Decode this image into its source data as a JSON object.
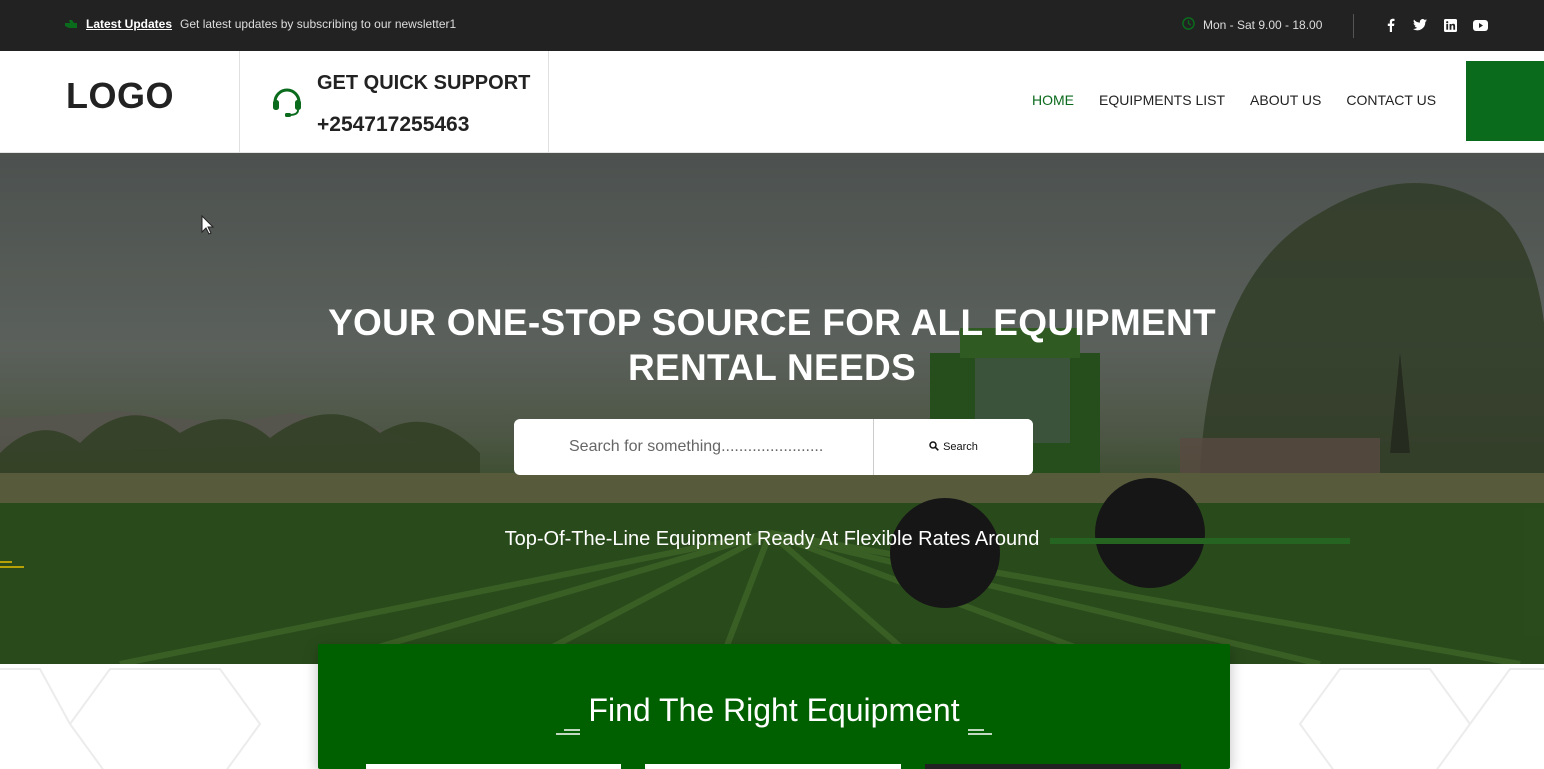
{
  "topbar": {
    "updates_label": "Latest Updates",
    "updates_text": "Get latest updates by subscribing to our newsletter1",
    "hours": "Mon - Sat 9.00 - 18.00",
    "socials": [
      "facebook-icon",
      "twitter-icon",
      "linkedin-icon",
      "youtube-icon"
    ]
  },
  "header": {
    "logo": "LOGO",
    "support_title": "GET QUICK SUPPORT",
    "support_phone": "+254717255463",
    "nav": [
      {
        "label": "HOME",
        "active": true
      },
      {
        "label": "EQUIPMENTS LIST",
        "active": false
      },
      {
        "label": "ABOUT US",
        "active": false
      },
      {
        "label": "CONTACT US",
        "active": false
      }
    ]
  },
  "hero": {
    "title_line1": "YOUR ONE-STOP SOURCE FOR ALL EQUIPMENT",
    "title_line2": "RENTAL NEEDS",
    "search_placeholder": "Search for something.......................",
    "search_button": "Search",
    "tagline": "Top-Of-The-Line Equipment Ready At Flexible Rates Around"
  },
  "find": {
    "title": "Find The Right Equipment"
  },
  "colors": {
    "brand_green": "#0b6b1d",
    "panel_green": "#006000",
    "topbar_bg": "#222222"
  }
}
